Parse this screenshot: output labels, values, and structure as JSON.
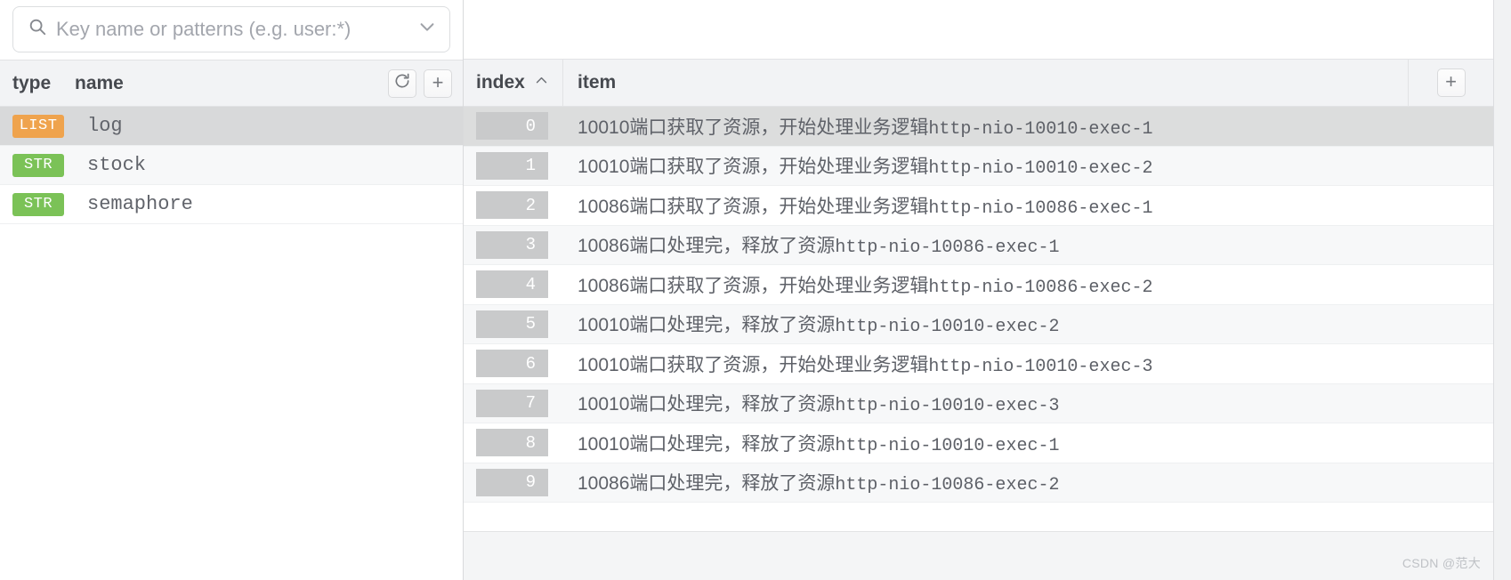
{
  "search": {
    "placeholder": "Key name or patterns (e.g. user:*)",
    "value": "",
    "search_icon": "search-icon",
    "dropdown_icon": "chevron-down-icon"
  },
  "key_panel": {
    "columns": {
      "type": "type",
      "name": "name"
    },
    "refresh_label": "refresh-icon",
    "add_label": "+",
    "rows": [
      {
        "type": "LIST",
        "name": "log",
        "selected": true,
        "type_color": "#efa34d"
      },
      {
        "type": "STR",
        "name": "stock",
        "selected": false,
        "type_color": "#7bc257"
      },
      {
        "type": "STR",
        "name": "semaphore",
        "selected": false,
        "type_color": "#7bc257"
      }
    ]
  },
  "value_panel": {
    "columns": {
      "index": "index",
      "item": "item"
    },
    "sort_icon": "caret-up-icon",
    "add_label": "+",
    "rows": [
      {
        "index": "0",
        "cn": "10010端口获取了资源，开始处理业务逻辑",
        "mono": "http-nio-10010-exec-1",
        "selected": true
      },
      {
        "index": "1",
        "cn": "10010端口获取了资源，开始处理业务逻辑",
        "mono": "http-nio-10010-exec-2",
        "selected": false
      },
      {
        "index": "2",
        "cn": "10086端口获取了资源，开始处理业务逻辑",
        "mono": "http-nio-10086-exec-1",
        "selected": false
      },
      {
        "index": "3",
        "cn": "10086端口处理完，释放了资源",
        "mono": "http-nio-10086-exec-1",
        "selected": false
      },
      {
        "index": "4",
        "cn": "10086端口获取了资源，开始处理业务逻辑",
        "mono": "http-nio-10086-exec-2",
        "selected": false
      },
      {
        "index": "5",
        "cn": "10010端口处理完，释放了资源",
        "mono": "http-nio-10010-exec-2",
        "selected": false
      },
      {
        "index": "6",
        "cn": "10010端口获取了资源，开始处理业务逻辑",
        "mono": "http-nio-10010-exec-3",
        "selected": false
      },
      {
        "index": "7",
        "cn": "10010端口处理完，释放了资源",
        "mono": "http-nio-10010-exec-3",
        "selected": false
      },
      {
        "index": "8",
        "cn": "10010端口处理完，释放了资源",
        "mono": "http-nio-10010-exec-1",
        "selected": false
      },
      {
        "index": "9",
        "cn": "10086端口处理完，释放了资源",
        "mono": "http-nio-10086-exec-2",
        "selected": false
      }
    ]
  },
  "watermark": {
    "text": "CSDN @范大"
  }
}
